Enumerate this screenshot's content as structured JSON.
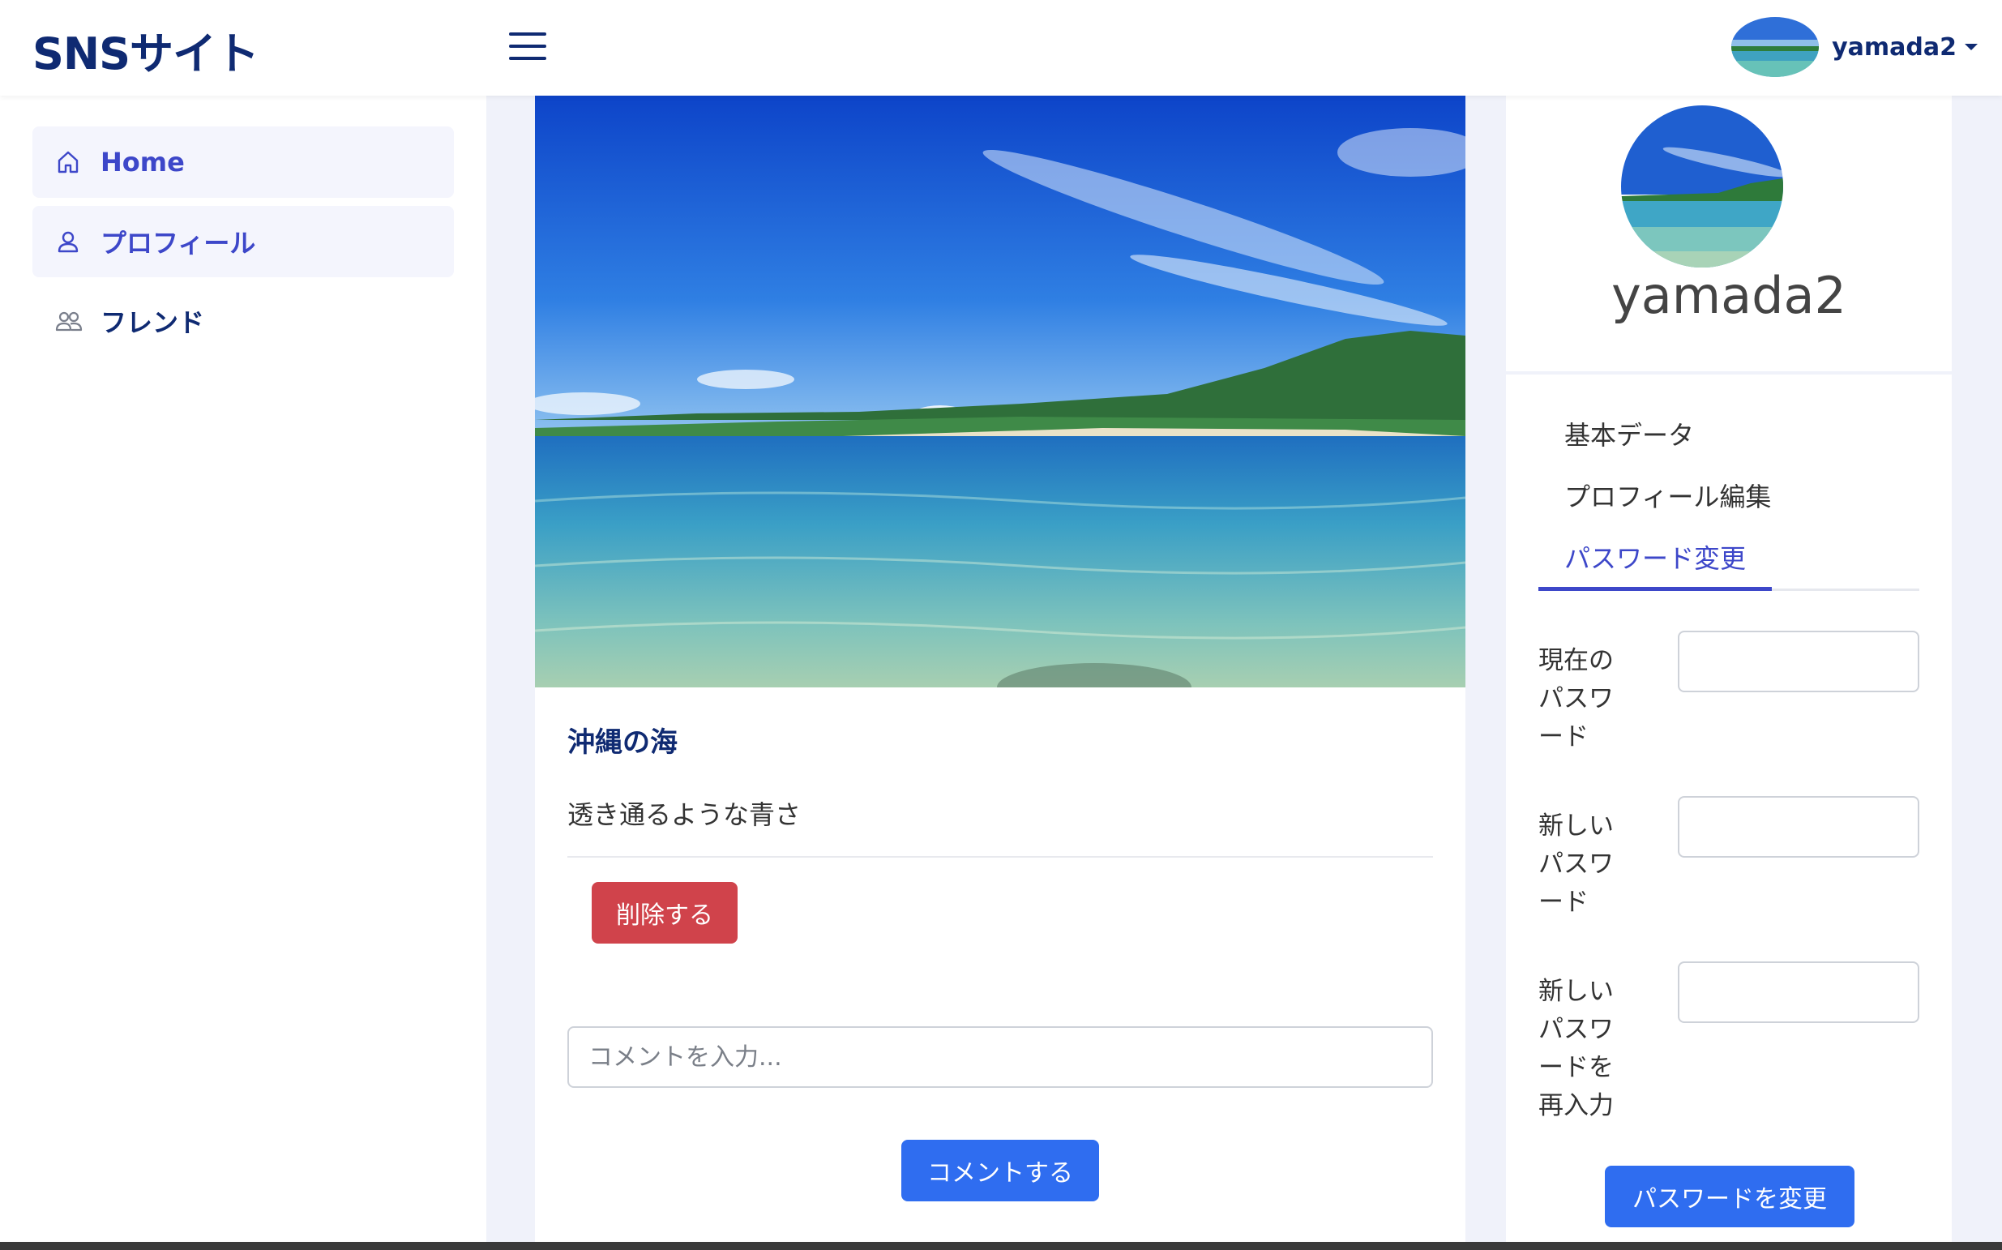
{
  "header": {
    "logo": "SNSサイト",
    "user_name": "yamada2"
  },
  "sidebar": {
    "items": [
      {
        "label": "Home",
        "icon": "home-icon"
      },
      {
        "label": "プロフィール",
        "icon": "user-icon"
      },
      {
        "label": "フレンド",
        "icon": "friends-icon"
      }
    ]
  },
  "post": {
    "title": "沖縄の海",
    "text": "透き通るような青さ",
    "delete_label": "削除する",
    "comment_placeholder": "コメントを入力...",
    "comment_button": "コメントする"
  },
  "profile": {
    "name": "yamada2"
  },
  "settings": {
    "tabs": [
      "基本データ",
      "プロフィール編集",
      "パスワード変更"
    ],
    "active_tab": "パスワード変更",
    "fields": [
      {
        "label_lines": [
          "現在の",
          "パスワ",
          "ード"
        ]
      },
      {
        "label_lines": [
          "新しい",
          "パスワ",
          "ード"
        ]
      },
      {
        "label_lines": [
          "新しい",
          "パスワ",
          "ードを",
          "再入力"
        ]
      }
    ],
    "submit_label": "パスワードを変更"
  },
  "colors": {
    "brand": "#0f2a72",
    "accent": "#3d47c9",
    "primary_button": "#2f6df0",
    "danger_button": "#d0434b"
  }
}
